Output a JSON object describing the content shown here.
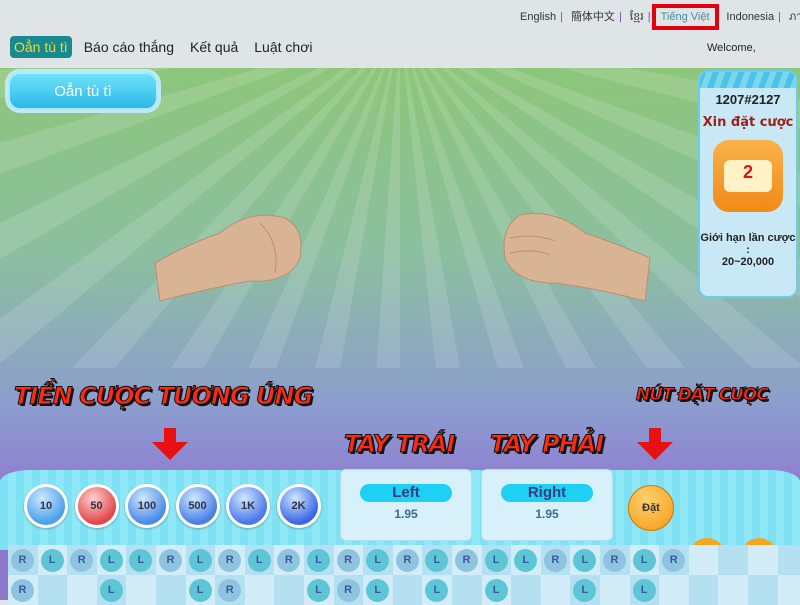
{
  "languages": [
    {
      "label": "English"
    },
    {
      "label": "簡体中文"
    },
    {
      "label": "ខ្មែរ"
    },
    {
      "label": "Tiếng Việt",
      "active": true
    },
    {
      "label": "Indonesia"
    },
    {
      "label": "ภาษาไทย"
    }
  ],
  "welcome": "Welcome,",
  "nav": [
    {
      "label": "Oẳn tù tì",
      "active": true
    },
    {
      "label": "Báo cáo thắng"
    },
    {
      "label": "Kết quả"
    },
    {
      "label": "Luật chơi"
    }
  ],
  "game_title": "Oẳn tù tì",
  "panel": {
    "round": "1207#2127",
    "status": "Xin đặt cược",
    "countdown": "2",
    "limit_label": "Giới hạn lần cược :",
    "limit": "20~20,000"
  },
  "annotations": {
    "chips": "TIỀN CƯỢC TƯƠNG ỨNG",
    "left": "TAY TRÁI",
    "right": "TAY PHẢI",
    "place": "NÚT ĐẶT CƯỢC"
  },
  "chips": [
    {
      "label": "10",
      "color": "#4aa0ea"
    },
    {
      "label": "50",
      "color": "#e04848"
    },
    {
      "label": "100",
      "color": "#4a8ae8"
    },
    {
      "label": "500",
      "color": "#4a7ee6"
    },
    {
      "label": "1K",
      "color": "#4a78ea"
    },
    {
      "label": "2K",
      "color": "#3a66e6"
    }
  ],
  "bets": {
    "left": {
      "label": "Left",
      "odds": "1.95"
    },
    "right": {
      "label": "Right",
      "odds": "1.95"
    }
  },
  "place_button": "Đặt",
  "history": {
    "row1": [
      "R",
      "L",
      "R",
      "L",
      "L",
      "R",
      "L",
      "R",
      "L",
      "R",
      "L",
      "R",
      "L",
      "R",
      "L",
      "R",
      "L",
      "L",
      "R",
      "L",
      "R",
      "L",
      "R",
      "",
      "",
      "",
      ""
    ],
    "row2": [
      "R",
      "",
      "",
      "L",
      "",
      "",
      "L",
      "R",
      "",
      "",
      "L",
      "R",
      "L",
      "",
      "L",
      "",
      "L",
      "",
      "",
      "L",
      "",
      "L",
      "",
      "",
      "",
      "",
      ""
    ]
  }
}
